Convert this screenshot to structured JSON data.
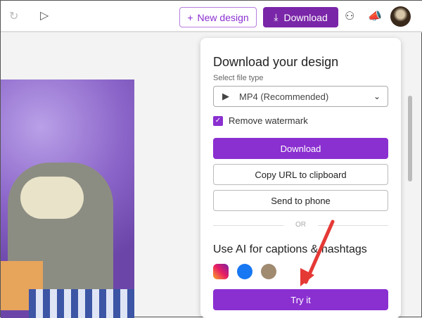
{
  "toolbar": {
    "new_design": "New design",
    "download": "Download"
  },
  "panel": {
    "title": "Download your design",
    "file_type_label": "Select file type",
    "file_type_value": "MP4 (Recommended)",
    "remove_watermark": "Remove watermark",
    "download": "Download",
    "copy_url": "Copy URL to clipboard",
    "send_to_phone": "Send to phone",
    "or": "OR",
    "ai_title": "Use AI for captions & hashtags",
    "try_it": "Try it"
  },
  "colors": {
    "accent": "#8a2fd0",
    "download_btn": "#7a26a8"
  }
}
